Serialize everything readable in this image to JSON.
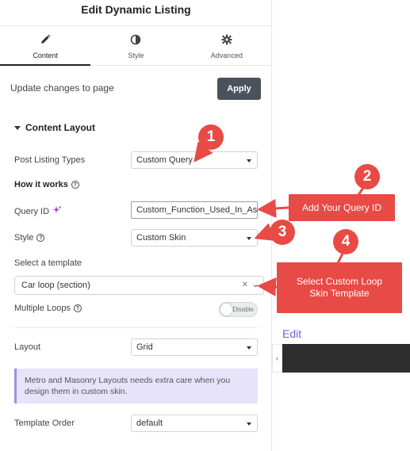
{
  "panel": {
    "title": "Edit Dynamic Listing",
    "tabs": [
      {
        "label": "Content",
        "icon": "pencil-icon",
        "active": true
      },
      {
        "label": "Style",
        "icon": "half-circle-icon",
        "active": false
      },
      {
        "label": "Advanced",
        "icon": "gear-icon",
        "active": false
      }
    ],
    "update_text": "Update changes to page",
    "apply_label": "Apply"
  },
  "content_layout": {
    "section_title": "Content Layout",
    "post_listing_types": {
      "label": "Post Listing Types",
      "value": "Custom Query"
    },
    "how_it_works": "How it works",
    "query_id": {
      "label": "Query ID",
      "value": "Custom_Function_Used_In_Ass"
    },
    "style": {
      "label": "Style",
      "value": "Custom Skin"
    },
    "select_template": {
      "label": "Select a template",
      "value": "Car loop (section)"
    },
    "multiple_loops": {
      "label": "Multiple Loops",
      "toggle_text": "Disable"
    },
    "layout": {
      "label": "Layout",
      "value": "Grid"
    },
    "notice": "Metro and Masonry Layouts needs extra care when you design them in custom skin.",
    "template_order": {
      "label": "Template Order",
      "value": "default"
    }
  },
  "preview": {
    "edit_link": "Edit"
  },
  "annotations": {
    "badges": [
      "1",
      "2",
      "3",
      "4"
    ],
    "callout_query_id": "Add Your Query ID",
    "callout_template": "Select Custom Loop Skin Template",
    "color": "#e84a45"
  }
}
